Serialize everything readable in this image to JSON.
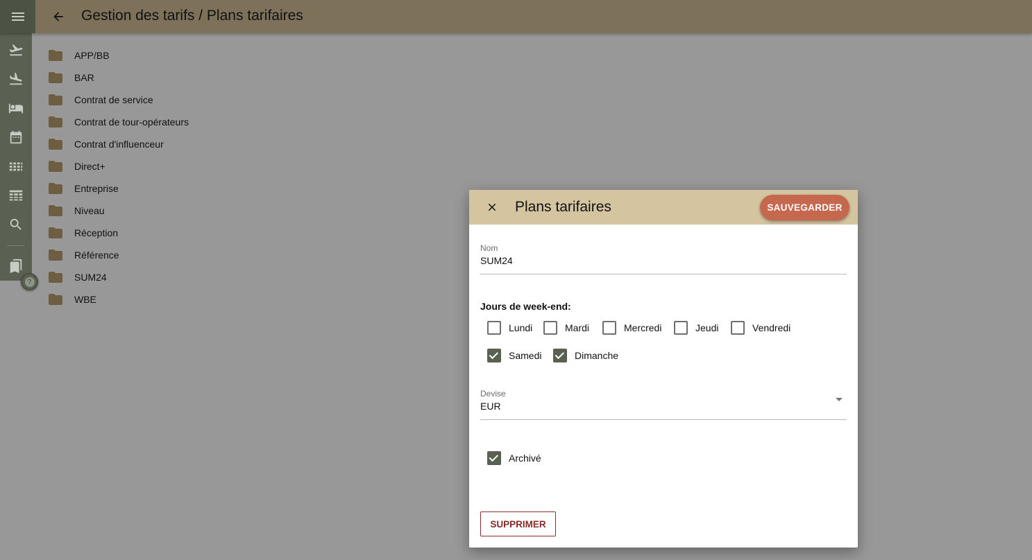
{
  "header": {
    "title": "Gestion des tarifs / Plans tarifaires",
    "menu_icon": "menu-icon",
    "back_icon": "arrow-back-icon"
  },
  "rail": {
    "items": [
      {
        "icon": "flight-takeoff-icon"
      },
      {
        "icon": "flight-land-icon"
      },
      {
        "icon": "hotel-bed-icon"
      },
      {
        "icon": "calendar-icon"
      },
      {
        "icon": "grid-icon"
      },
      {
        "icon": "table-icon"
      },
      {
        "icon": "search-icon"
      },
      {
        "icon": "bookmarks-icon"
      }
    ],
    "help_label": "?"
  },
  "folders": [
    "APP/BB",
    "BAR",
    "Contrat de service",
    "Contrat de tour-opérateurs",
    "Contrat d'influenceur",
    "Direct+",
    "Entreprise",
    "Niveau",
    "Réception",
    "Référence",
    "SUM24",
    "WBE"
  ],
  "dialog": {
    "title": "Plans tarifaires",
    "save_label": "SAUVEGARDER",
    "nom": {
      "label": "Nom",
      "value": "SUM24"
    },
    "weekend_label": "Jours de week-end:",
    "days": [
      {
        "label": "Lundi",
        "checked": false
      },
      {
        "label": "Mardi",
        "checked": false
      },
      {
        "label": "Mercredi",
        "checked": false
      },
      {
        "label": "Jeudi",
        "checked": false
      },
      {
        "label": "Vendredi",
        "checked": false
      },
      {
        "label": "Samedi",
        "checked": true
      },
      {
        "label": "Dimanche",
        "checked": true
      }
    ],
    "devise": {
      "label": "Devise",
      "value": "EUR"
    },
    "archive": {
      "label": "Archivé",
      "checked": true
    },
    "delete_label": "SUPPRIMER"
  },
  "colors": {
    "appbar": "#7e715a",
    "rail": "#5b6152",
    "dialog_header": "#d4c4a0",
    "save_button": "#c5684e",
    "delete_text": "#8a2a2a",
    "folder": "#6d5e42"
  }
}
